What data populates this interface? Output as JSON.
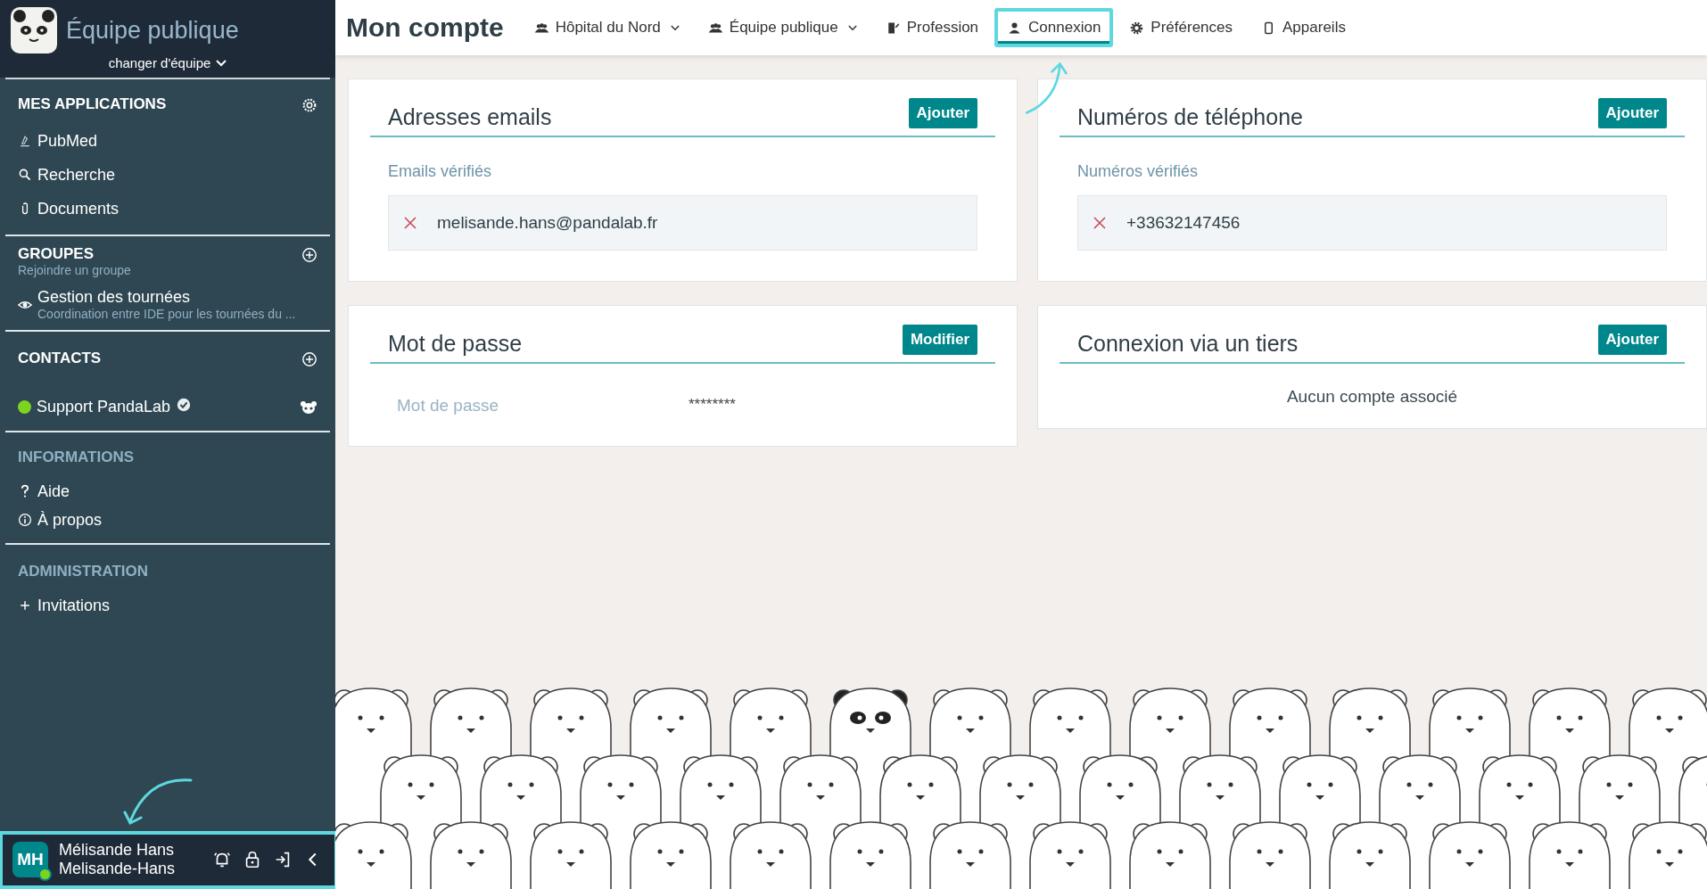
{
  "sidebar": {
    "team": {
      "name": "Équipe publique",
      "switch_label": "changer d'équipe"
    },
    "sections": [
      {
        "kind": "apps",
        "title": "MES APPLICATIONS",
        "items": [
          {
            "label": "PubMed"
          },
          {
            "label": "Recherche"
          },
          {
            "label": "Documents"
          }
        ]
      },
      {
        "kind": "groups",
        "title": "GROUPES",
        "subtitle": "Rejoindre un groupe",
        "items": [
          {
            "label": "Gestion des tournées",
            "description": "Coordination entre IDE pour les tournées du ..."
          }
        ]
      },
      {
        "kind": "contacts",
        "title": "CONTACTS",
        "items": [
          {
            "label": "Support PandaLab",
            "online": true,
            "verified": true
          }
        ]
      },
      {
        "kind": "info",
        "title": "INFORMATIONS",
        "items": [
          {
            "label": "Aide"
          },
          {
            "label": "À propos"
          }
        ]
      },
      {
        "kind": "admin",
        "title": "ADMINISTRATION",
        "items": [
          {
            "label": "Invitations"
          }
        ]
      }
    ],
    "user": {
      "initials": "MH",
      "name": "Mélisande Hans",
      "username": "Melisande-Hans",
      "online": true,
      "highlighted": true
    }
  },
  "topbar": {
    "title": "Mon compte",
    "tabs": [
      {
        "label": "Hôpital du Nord",
        "dropdown": true,
        "selected": false
      },
      {
        "label": "Équipe publique",
        "dropdown": true,
        "selected": false
      },
      {
        "label": "Profession",
        "dropdown": false,
        "selected": false
      },
      {
        "label": "Connexion",
        "dropdown": false,
        "selected": true
      },
      {
        "label": "Préférences",
        "dropdown": false,
        "selected": false
      },
      {
        "label": "Appareils",
        "dropdown": false,
        "selected": false
      }
    ]
  },
  "cards": [
    {
      "kind": "list",
      "title": "Adresses emails",
      "button": "Ajouter",
      "list_label": "Emails vérifiés",
      "entries": [
        "melisande.hans@pandalab.fr"
      ]
    },
    {
      "kind": "list",
      "title": "Numéros de téléphone",
      "button": "Ajouter",
      "list_label": "Numéros vérifiés",
      "entries": [
        "+33632147456"
      ]
    },
    {
      "kind": "field",
      "title": "Mot de passe",
      "button": "Modifier",
      "field_label": "Mot de passe",
      "value": "********"
    },
    {
      "kind": "empty",
      "title": "Connexion via un tiers",
      "button": "Ajouter",
      "message": "Aucun compte associé"
    }
  ]
}
